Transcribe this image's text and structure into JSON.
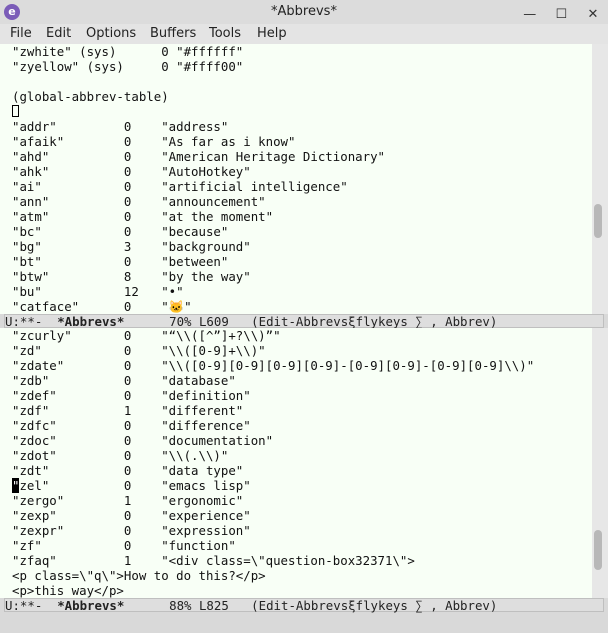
{
  "window": {
    "title": "*Abbrevs*",
    "app_icon": "emacs-icon",
    "controls": {
      "minimize": "—",
      "maximize": "☐",
      "close": "✕"
    }
  },
  "menu": [
    "File",
    "Edit",
    "Options",
    "Buffers",
    "Tools",
    "Help"
  ],
  "top_pane": {
    "lines": [
      "\"zwhite\" (sys)      0 \"#ffffff\"",
      "\"zyellow\" (sys)     0 \"#ffff00\"",
      "",
      "(global-abbrev-table)",
      "",
      "\"addr\"         0    \"address\"",
      "\"afaik\"        0    \"As far as i know\"",
      "\"ahd\"          0    \"American Heritage Dictionary\"",
      "\"ahk\"          0    \"AutoHotkey\"",
      "\"ai\"           0    \"artificial intelligence\"",
      "\"ann\"          0    \"announcement\"",
      "\"atm\"          0    \"at the moment\"",
      "\"bc\"           0    \"because\"",
      "\"bg\"           3    \"background\"",
      "\"bt\"           0    \"between\"",
      "\"btw\"          8    \"by the way\"",
      "\"bu\"           12   \"•\"",
      "\"catface\"      0    \"🐱\""
    ],
    "modeline": {
      "left": "U:**-  ",
      "buffer": "*Abbrevs*",
      "right": "      70% L609   (Edit-Abbrevsξflykeys ∑ , Abbrev)"
    }
  },
  "bottom_pane": {
    "lines": [
      "\"zcurly\"       0    \"“\\\\([^”]+?\\\\)”\"",
      "\"zd\"           0    \"\\\\([0-9]+\\\\)\"",
      "\"zdate\"        0    \"\\\\([0-9][0-9][0-9][0-9]-[0-9][0-9]-[0-9][0-9]\\\\)\"",
      "\"zdb\"          0    \"database\"",
      "\"zdef\"         0    \"definition\"",
      "\"zdf\"          1    \"different\"",
      "\"zdfc\"         0    \"difference\"",
      "\"zdoc\"         0    \"documentation\"",
      "\"zdot\"         0    \"\\\\(.\\\\)\"",
      "\"zdt\"          0    \"data type\"",
      "zel\"          0    \"emacs lisp\"",
      "\"zergo\"        1    \"ergonomic\"",
      "\"zexp\"         0    \"experience\"",
      "\"zexpr\"        0    \"expression\"",
      "\"zf\"           0    \"function\"",
      "\"zfaq\"         1    \"<div class=\\\"question-box32371\\\">",
      "<p class=\\\"q\\\">How to do this?</p>",
      "<p>this way</p>"
    ],
    "cursor_char": "\"",
    "modeline": {
      "left": "U:**-  ",
      "buffer": "*Abbrevs*",
      "right": "      88% L825   (Edit-Abbrevsξflykeys ∑ , Abbrev)"
    }
  }
}
